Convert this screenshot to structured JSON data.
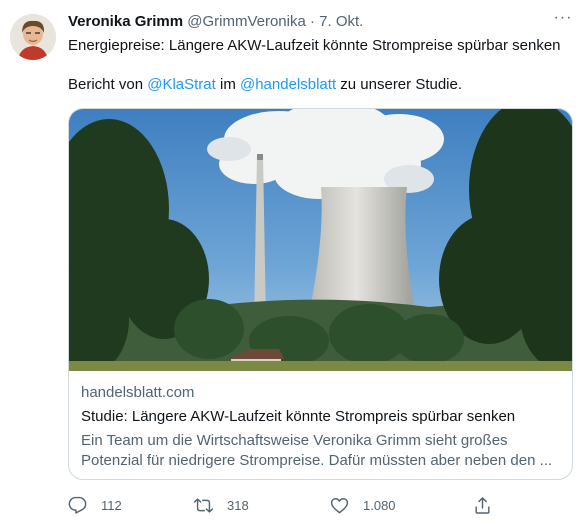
{
  "author": {
    "name": "Veronika Grimm",
    "handle": "@GrimmVeronika",
    "separator": "·",
    "date": "7. Okt."
  },
  "more_label": "···",
  "tweet": {
    "line1": "Energiepreise: Längere AKW-Laufzeit könnte Strompreise spürbar senken",
    "line2_prefix": "Bericht von ",
    "mention1": "@KlaStrat",
    "line2_mid": " im ",
    "mention2": "@handelsblatt",
    "line2_suffix": " zu unserer Studie."
  },
  "card": {
    "domain": "handelsblatt.com",
    "title": "Studie: Längere AKW-Laufzeit könnte Strompreis spürbar senken",
    "description": "Ein Team um die Wirtschaftsweise Veronika Grimm sieht großes Potenzial für niedrigere Strompreise. Dafür müssten aber neben den ..."
  },
  "actions": {
    "reply_count": "112",
    "retweet_count": "318",
    "like_count": "1.080"
  },
  "icons": {
    "reply": "reply-icon",
    "retweet": "retweet-icon",
    "like": "heart-icon",
    "share": "share-icon",
    "more": "more-dots-icon"
  },
  "colors": {
    "link": "#1d9bf0",
    "secondary_text": "#536471",
    "primary_text": "#0f1419",
    "border": "#cfd9de"
  }
}
